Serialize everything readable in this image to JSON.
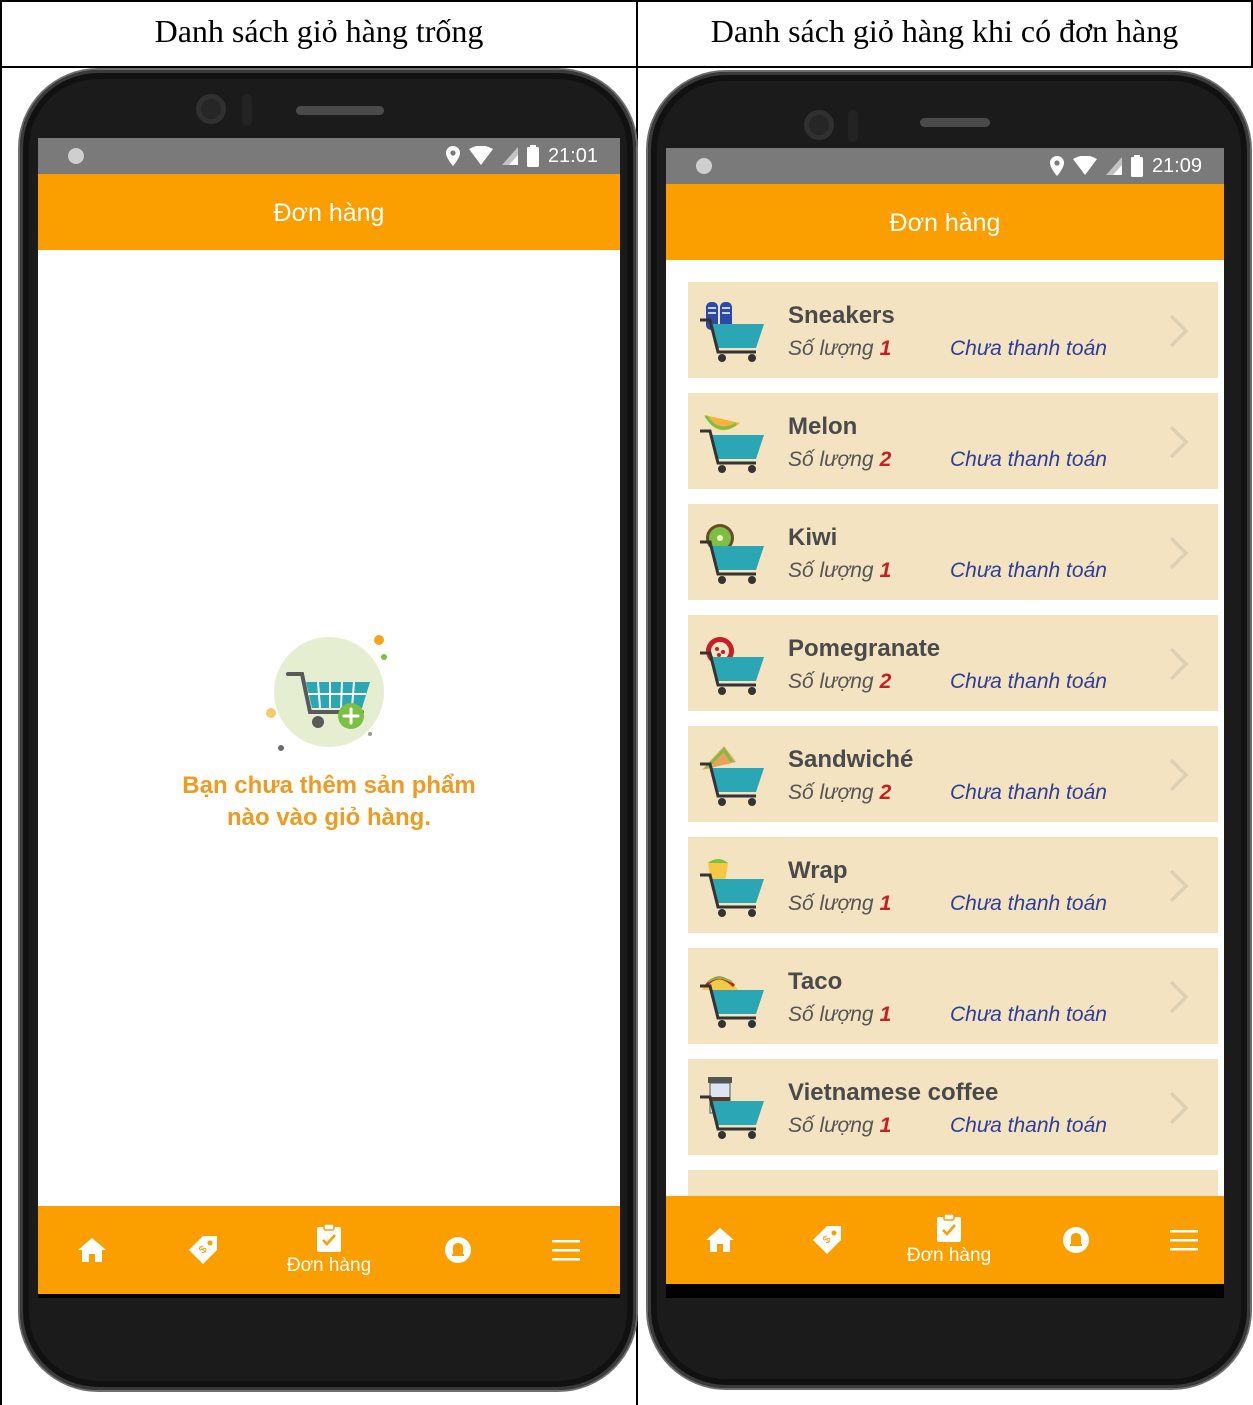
{
  "captions": {
    "left": "Danh sách giỏ hàng trống",
    "right": "Danh sách giỏ hàng khi có đơn hàng"
  },
  "left_phone": {
    "status_time": "21:01",
    "header_title": "Đơn hàng",
    "empty_text_line1": "Bạn chưa thêm sản phẩm",
    "empty_text_line2": "nào vào giỏ hàng.",
    "nav_active_label": "Đơn hàng"
  },
  "right_phone": {
    "status_time": "21:09",
    "header_title": "Đơn hàng",
    "nav_active_label": "Đơn hàng",
    "qty_label": "Số lượng",
    "orders": [
      {
        "name": "Sneakers",
        "qty": "1",
        "status": "Chưa thanh toán",
        "icon": "sneakers-icon"
      },
      {
        "name": "Melon",
        "qty": "2",
        "status": "Chưa thanh toán",
        "icon": "melon-icon"
      },
      {
        "name": "Kiwi",
        "qty": "1",
        "status": "Chưa thanh toán",
        "icon": "kiwi-icon"
      },
      {
        "name": "Pomegranate",
        "qty": "2",
        "status": "Chưa thanh toán",
        "icon": "pomegranate-icon"
      },
      {
        "name": "Sandwiché",
        "qty": "2",
        "status": "Chưa thanh toán",
        "icon": "sandwich-icon"
      },
      {
        "name": "Wrap",
        "qty": "1",
        "status": "Chưa thanh toán",
        "icon": "wrap-icon"
      },
      {
        "name": "Taco",
        "qty": "1",
        "status": "Chưa thanh toán",
        "icon": "taco-icon"
      },
      {
        "name": "Vietnamese coffee",
        "qty": "1",
        "status": "Chưa thanh toán",
        "icon": "coffee-icon"
      }
    ]
  },
  "colors": {
    "accent": "#fb9e00",
    "item_bg": "#f3e3c1",
    "status_text": "#2c3e9a",
    "qty_number": "#c81d25",
    "empty_text": "#f09a1f"
  }
}
